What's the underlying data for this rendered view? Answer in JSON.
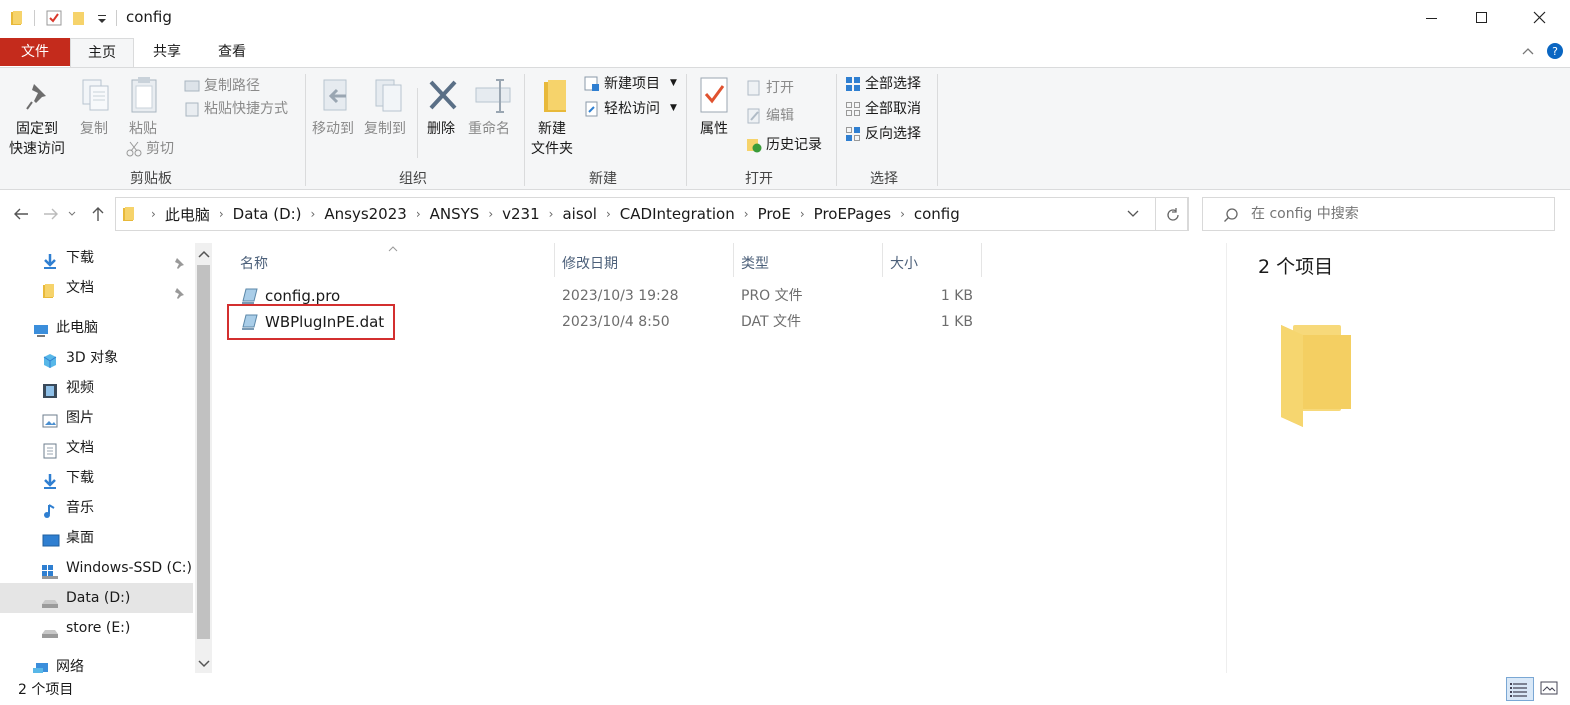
{
  "window": {
    "title": "config"
  },
  "ribbon_tabs": [
    "文件",
    "主页",
    "共享",
    "查看"
  ],
  "ribbon": {
    "clipboard": {
      "pin_label1": "固定到",
      "pin_label2": "快速访问",
      "copy": "复制",
      "paste": "粘贴",
      "copy_path": "复制路径",
      "paste_shortcut": "粘贴快捷方式",
      "cut": "剪切",
      "group": "剪贴板"
    },
    "organize": {
      "move_to": "移动到",
      "copy_to": "复制到",
      "delete": "删除",
      "rename": "重命名",
      "group": "组织"
    },
    "new": {
      "new_folder1": "新建",
      "new_folder2": "文件夹",
      "new_item": "新建项目",
      "easy_access": "轻松访问",
      "group": "新建"
    },
    "open": {
      "properties": "属性",
      "open": "打开",
      "edit": "编辑",
      "history": "历史记录",
      "group": "打开"
    },
    "select": {
      "select_all": "全部选择",
      "select_none": "全部取消",
      "invert": "反向选择",
      "group": "选择"
    }
  },
  "breadcrumb": [
    "此电脑",
    "Data (D:)",
    "Ansys2023",
    "ANSYS",
    "v231",
    "aisol",
    "CADIntegration",
    "ProE",
    "ProEPages",
    "config"
  ],
  "search": {
    "placeholder": "在 config 中搜索"
  },
  "nav": {
    "quick": [
      {
        "label": "下载"
      },
      {
        "label": "文档"
      }
    ],
    "this_pc": "此电脑",
    "pc_items": [
      "3D 对象",
      "视频",
      "图片",
      "文档",
      "下载",
      "音乐",
      "桌面",
      "Windows-SSD (C:)",
      "Data (D:)",
      "store (E:)"
    ],
    "network": "网络"
  },
  "columns": [
    "名称",
    "修改日期",
    "类型",
    "大小"
  ],
  "files": [
    {
      "name": "config.pro",
      "date": "2023/10/3 19:28",
      "type": "PRO 文件",
      "size": "1 KB"
    },
    {
      "name": "WBPlugInPE.dat",
      "date": "2023/10/4 8:50",
      "type": "DAT 文件",
      "size": "1 KB"
    }
  ],
  "preview": {
    "count": "2 个项目"
  },
  "status": {
    "count": "2 个项目"
  },
  "colors": {
    "file_tab": "#c42b1c",
    "highlight_box": "#d32f2f",
    "selected_nav": "#e5e5e5",
    "accent": "#0a66c2"
  }
}
